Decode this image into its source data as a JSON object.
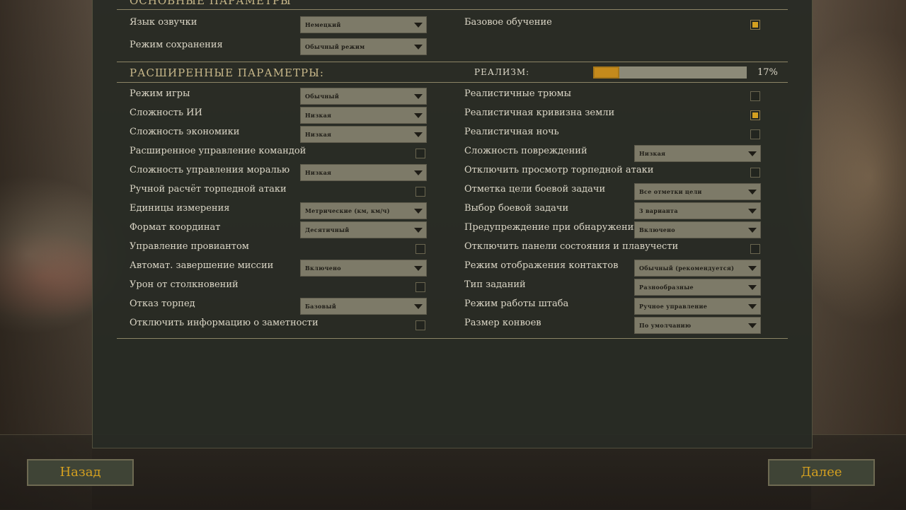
{
  "basic": {
    "title": "ОСНОВНЫЕ ПАРАМЕТРЫ",
    "voice_language": {
      "label": "Язык озвучки",
      "value": "Немецкий"
    },
    "save_mode": {
      "label": "Режим сохранения",
      "value": "Обычный режим"
    },
    "tutorial": {
      "label": "Базовое обучение",
      "checked": true
    }
  },
  "advanced": {
    "title": "РАСШИРЕННЫЕ ПАРАМЕТРЫ:",
    "realism_label": "РЕАЛИЗМ:",
    "realism_value": "17%",
    "realism_fraction": 0.17,
    "left": [
      {
        "label": "Режим игры",
        "type": "dropdown",
        "value": "Обычный"
      },
      {
        "label": "Сложность ИИ",
        "type": "dropdown",
        "value": "Низкая"
      },
      {
        "label": "Сложность экономики",
        "type": "dropdown",
        "value": "Низкая"
      },
      {
        "label": "Расширенное управление командой",
        "type": "checkbox",
        "checked": false
      },
      {
        "label": "Сложность управления моралью",
        "type": "dropdown",
        "value": "Низкая"
      },
      {
        "label": "Ручной расчёт торпедной атаки",
        "type": "checkbox",
        "checked": false
      },
      {
        "label": "Единицы измерения",
        "type": "dropdown",
        "value": "Метрические (км, км/ч)"
      },
      {
        "label": "Формат координат",
        "type": "dropdown",
        "value": "Десятичный"
      },
      {
        "label": "Управление провиантом",
        "type": "checkbox",
        "checked": false
      },
      {
        "label": "Автомат. завершение миссии",
        "type": "dropdown",
        "value": "Включено"
      },
      {
        "label": "Урон от столкновений",
        "type": "checkbox",
        "checked": false
      },
      {
        "label": "Отказ торпед",
        "type": "dropdown",
        "value": "Базовый"
      },
      {
        "label": "Отключить информацию о заметности",
        "type": "checkbox",
        "checked": false
      }
    ],
    "right": [
      {
        "label": "Реалистичные трюмы",
        "type": "checkbox",
        "checked": false
      },
      {
        "label": "Реалистичная кривизна земли",
        "type": "checkbox",
        "checked": true
      },
      {
        "label": "Реалистичная ночь",
        "type": "checkbox",
        "checked": false
      },
      {
        "label": "Сложность повреждений",
        "type": "dropdown",
        "value": "Низкая"
      },
      {
        "label": "Отключить просмотр торпедной атаки",
        "type": "checkbox",
        "checked": false
      },
      {
        "label": "Отметка цели боевой задачи",
        "type": "dropdown",
        "value": "Все отметки цели"
      },
      {
        "label": "Выбор боевой задачи",
        "type": "dropdown",
        "value": "3 варианта"
      },
      {
        "label": "Предупреждение при обнаружении",
        "type": "dropdown",
        "value": "Включено"
      },
      {
        "label": "Отключить панели состояния и плавучести",
        "type": "checkbox",
        "checked": false
      },
      {
        "label": "Режим отображения контактов",
        "type": "dropdown",
        "value": "Обычный (рекомендуется)"
      },
      {
        "label": "Тип заданий",
        "type": "dropdown",
        "value": "Разнообразные"
      },
      {
        "label": "Режим работы штаба",
        "type": "dropdown",
        "value": "Ручное управление"
      },
      {
        "label": "Размер конвоев",
        "type": "dropdown",
        "value": "По умолчанию"
      }
    ]
  },
  "buttons": {
    "back": "Назад",
    "next": "Далее"
  },
  "colors": {
    "accent": "#d4a020",
    "realism_fill": "#c48a1c",
    "dropdown_bg": "#7d7a68"
  }
}
